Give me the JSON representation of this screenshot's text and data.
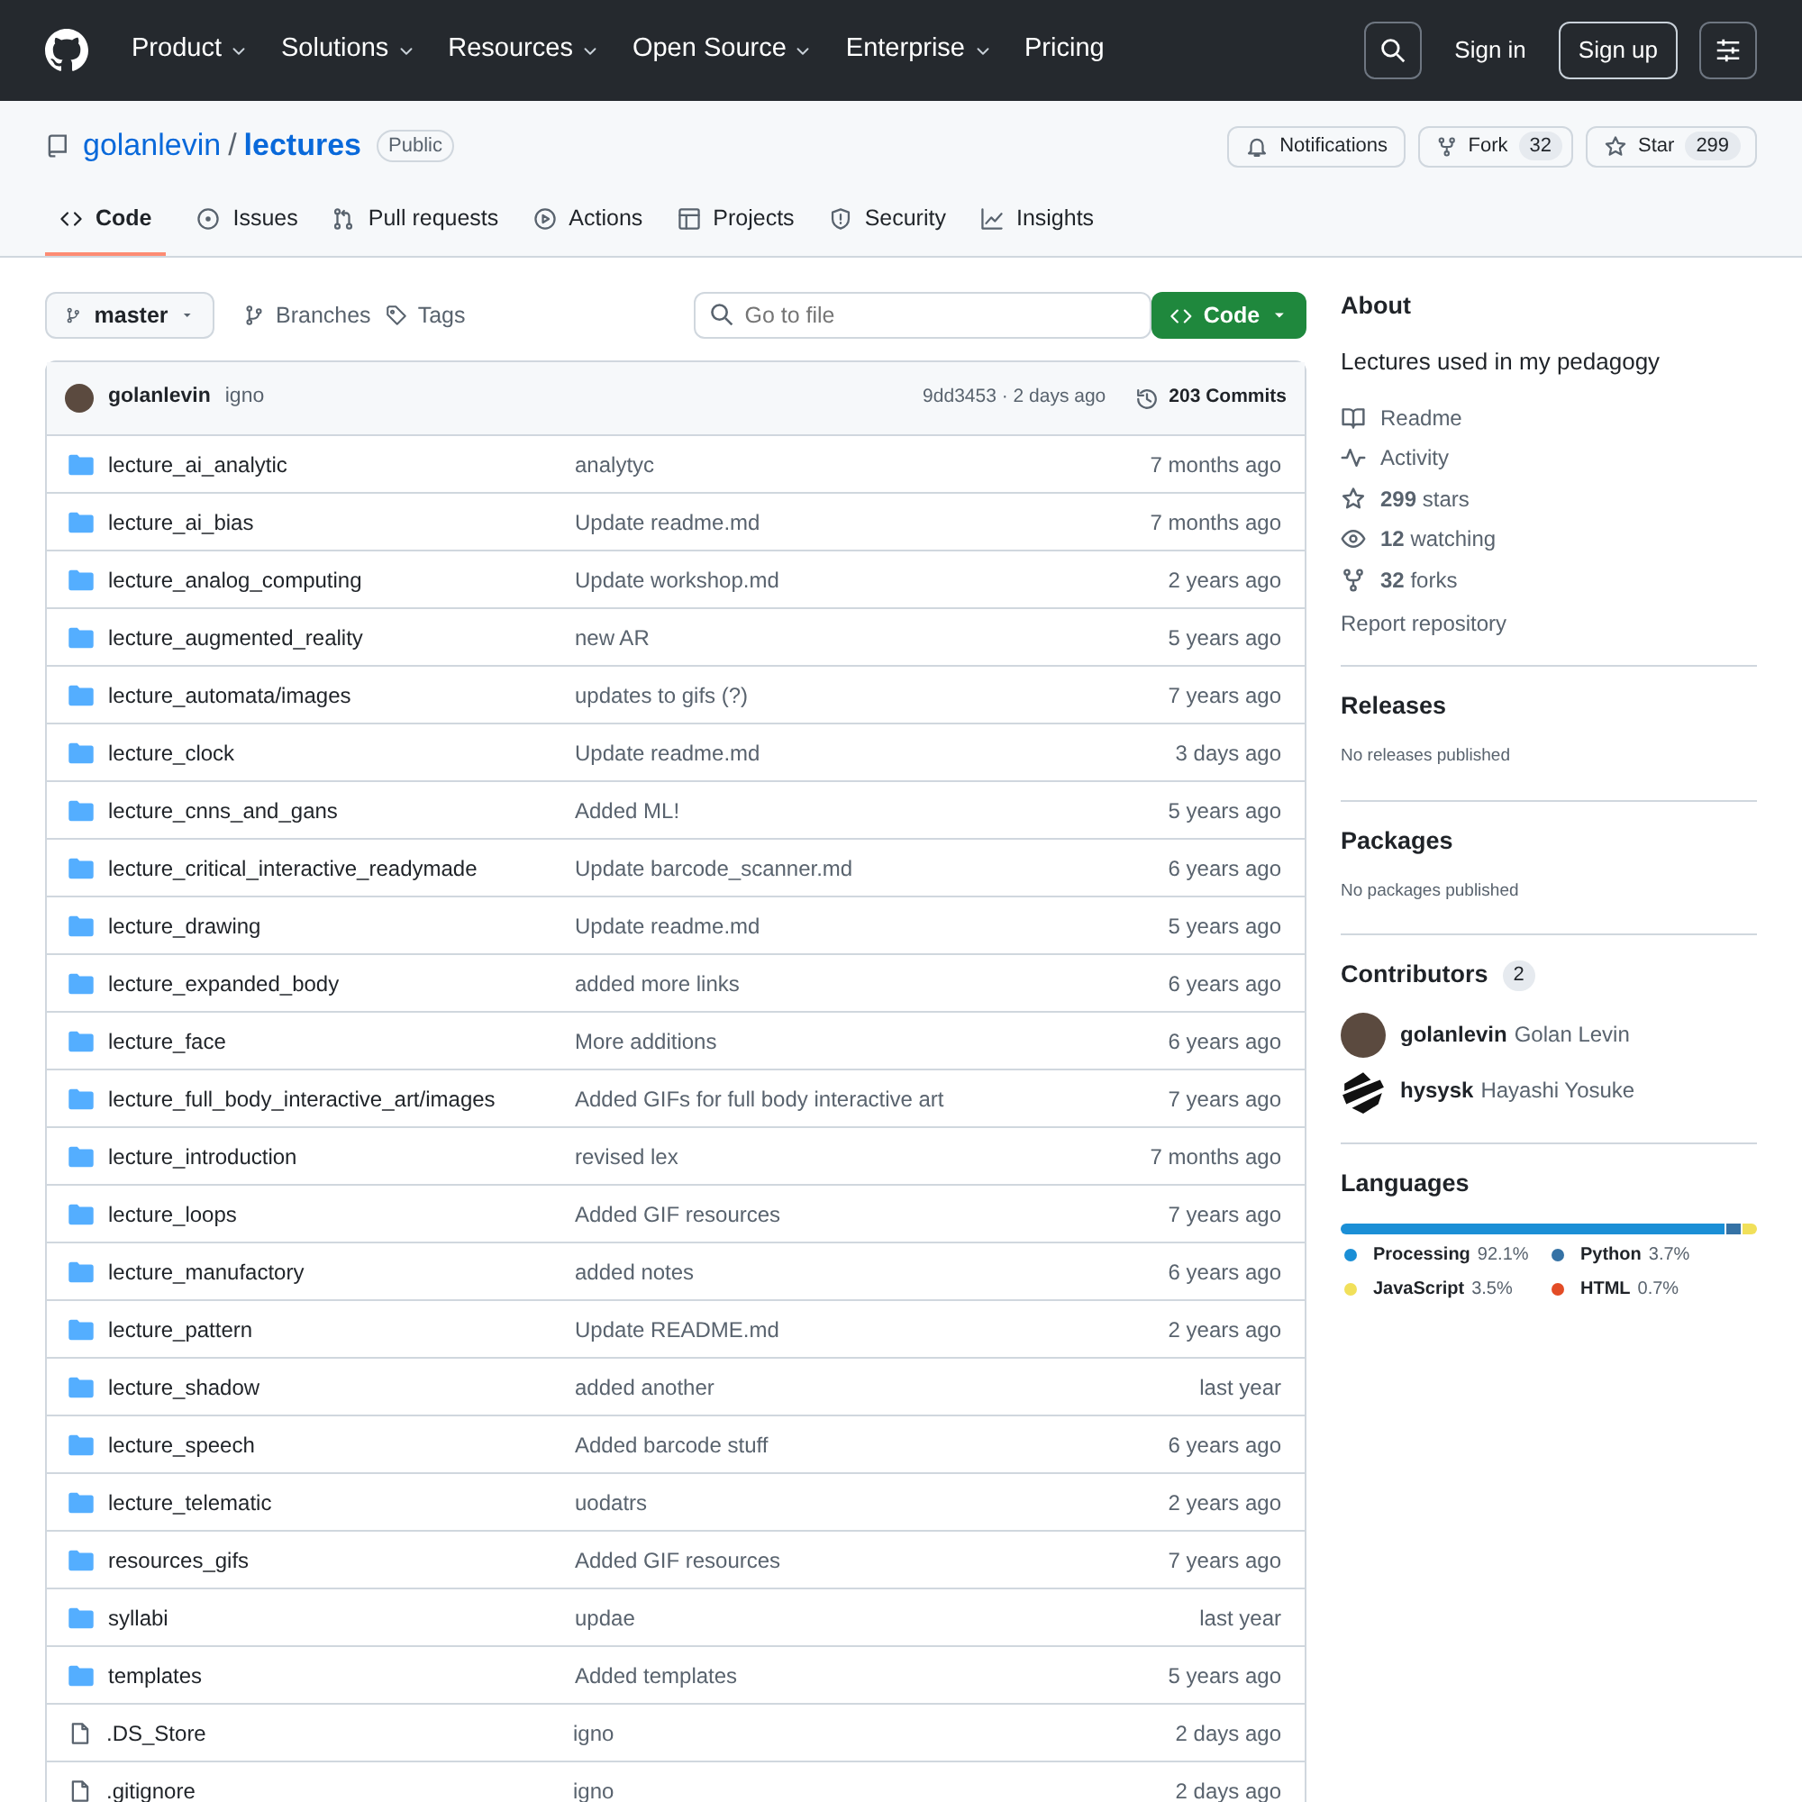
{
  "nav": {
    "items": [
      {
        "label": "Product",
        "dropdown": true
      },
      {
        "label": "Solutions",
        "dropdown": true
      },
      {
        "label": "Resources",
        "dropdown": true
      },
      {
        "label": "Open Source",
        "dropdown": true
      },
      {
        "label": "Enterprise",
        "dropdown": true
      },
      {
        "label": "Pricing",
        "dropdown": false
      }
    ],
    "sign_in": "Sign in",
    "sign_up": "Sign up"
  },
  "repo": {
    "owner": "golanlevin",
    "separator": "/",
    "name": "lectures",
    "visibility": "Public",
    "actions": [
      {
        "kind": "bell",
        "label": "Notifications"
      },
      {
        "kind": "fork",
        "label": "Fork",
        "count": "32"
      },
      {
        "kind": "star",
        "label": "Star",
        "count": "299"
      }
    ]
  },
  "tabs": [
    {
      "label": "Code",
      "selected": true
    },
    {
      "label": "Issues",
      "selected": false
    },
    {
      "label": "Pull requests",
      "selected": false
    },
    {
      "label": "Actions",
      "selected": false
    },
    {
      "label": "Projects",
      "selected": false
    },
    {
      "label": "Security",
      "selected": false
    },
    {
      "label": "Insights",
      "selected": false
    }
  ],
  "toolbar": {
    "branch": "master",
    "branches": "Branches",
    "tags": "Tags",
    "search": {
      "placeholder": "Go to file"
    },
    "code_button": "Code"
  },
  "commit": {
    "author": "golanlevin",
    "message": "igno",
    "hash_time": "9dd3453 · 2 days ago",
    "commits": "203 Commits"
  },
  "files": [
    {
      "kind": "folder",
      "name": "lecture_ai_analytic",
      "message": "analytyc",
      "time": "7 months ago"
    },
    {
      "kind": "folder",
      "name": "lecture_ai_bias",
      "message": "Update readme.md",
      "time": "7 months ago"
    },
    {
      "kind": "folder",
      "name": "lecture_analog_computing",
      "message": "Update workshop.md",
      "time": "2 years ago"
    },
    {
      "kind": "folder",
      "name": "lecture_augmented_reality",
      "message": "new AR",
      "time": "5 years ago"
    },
    {
      "kind": "folder",
      "name": "lecture_automata/images",
      "message": "updates to gifs (?)",
      "time": "7 years ago"
    },
    {
      "kind": "folder",
      "name": "lecture_clock",
      "message": "Update readme.md",
      "time": "3 days ago"
    },
    {
      "kind": "folder",
      "name": "lecture_cnns_and_gans",
      "message": "Added ML!",
      "time": "5 years ago"
    },
    {
      "kind": "folder",
      "name": "lecture_critical_interactive_readymade",
      "message": "Update barcode_scanner.md",
      "time": "6 years ago"
    },
    {
      "kind": "folder",
      "name": "lecture_drawing",
      "message": "Update readme.md",
      "time": "5 years ago"
    },
    {
      "kind": "folder",
      "name": "lecture_expanded_body",
      "message": "added more links",
      "time": "6 years ago"
    },
    {
      "kind": "folder",
      "name": "lecture_face",
      "message": "More additions",
      "time": "6 years ago"
    },
    {
      "kind": "folder",
      "name": "lecture_full_body_interactive_art/images",
      "message": "Added GIFs for full body interactive art",
      "time": "7 years ago"
    },
    {
      "kind": "folder",
      "name": "lecture_introduction",
      "message": "revised lex",
      "time": "7 months ago"
    },
    {
      "kind": "folder",
      "name": "lecture_loops",
      "message": "Added GIF resources",
      "time": "7 years ago"
    },
    {
      "kind": "folder",
      "name": "lecture_manufactory",
      "message": "added notes",
      "time": "6 years ago"
    },
    {
      "kind": "folder",
      "name": "lecture_pattern",
      "message": "Update README.md",
      "time": "2 years ago"
    },
    {
      "kind": "folder",
      "name": "lecture_shadow",
      "message": "added another",
      "time": "last year"
    },
    {
      "kind": "folder",
      "name": "lecture_speech",
      "message": "Added barcode stuff",
      "time": "6 years ago"
    },
    {
      "kind": "folder",
      "name": "lecture_telematic",
      "message": "uodatrs",
      "time": "2 years ago"
    },
    {
      "kind": "folder",
      "name": "resources_gifs",
      "message": "Added GIF resources",
      "time": "7 years ago"
    },
    {
      "kind": "folder",
      "name": "syllabi",
      "message": "updae",
      "time": "last year"
    },
    {
      "kind": "folder",
      "name": "templates",
      "message": "Added templates",
      "time": "5 years ago"
    },
    {
      "kind": "file",
      "name": ".DS_Store",
      "message": "igno",
      "time": "2 days ago"
    },
    {
      "kind": "file",
      "name": ".gitignore",
      "message": "igno",
      "time": "2 days ago"
    }
  ],
  "about": {
    "title": "About",
    "description": "Lectures used in my pedagogy",
    "links": [
      {
        "kind": "book",
        "text": "Readme"
      },
      {
        "kind": "pulse",
        "text": "Activity"
      },
      {
        "kind": "star",
        "text": "**299** stars"
      },
      {
        "kind": "eye",
        "text": "**12** watching"
      },
      {
        "kind": "fork",
        "text": "**32** forks"
      }
    ],
    "report": "Report repository"
  },
  "releases": {
    "title": "Releases",
    "note": "No releases published"
  },
  "packages": {
    "title": "Packages",
    "note": "No packages published"
  },
  "contributors": {
    "title": "Contributors",
    "count": "2",
    "people": [
      {
        "login": "golanlevin",
        "name": "Golan Levin"
      },
      {
        "login": "hysysk",
        "name": "Hayashi Yosuke"
      }
    ]
  },
  "languages": {
    "title": "Languages",
    "items": [
      {
        "name": "Processing",
        "percent": "92.1%",
        "color": "#1b8fd6"
      },
      {
        "name": "Python",
        "percent": "3.7%",
        "color": "#3572a5"
      },
      {
        "name": "JavaScript",
        "percent": "3.5%",
        "color": "#f1e05a"
      },
      {
        "name": "HTML",
        "percent": "0.7%",
        "color": "#e34c26"
      }
    ]
  }
}
